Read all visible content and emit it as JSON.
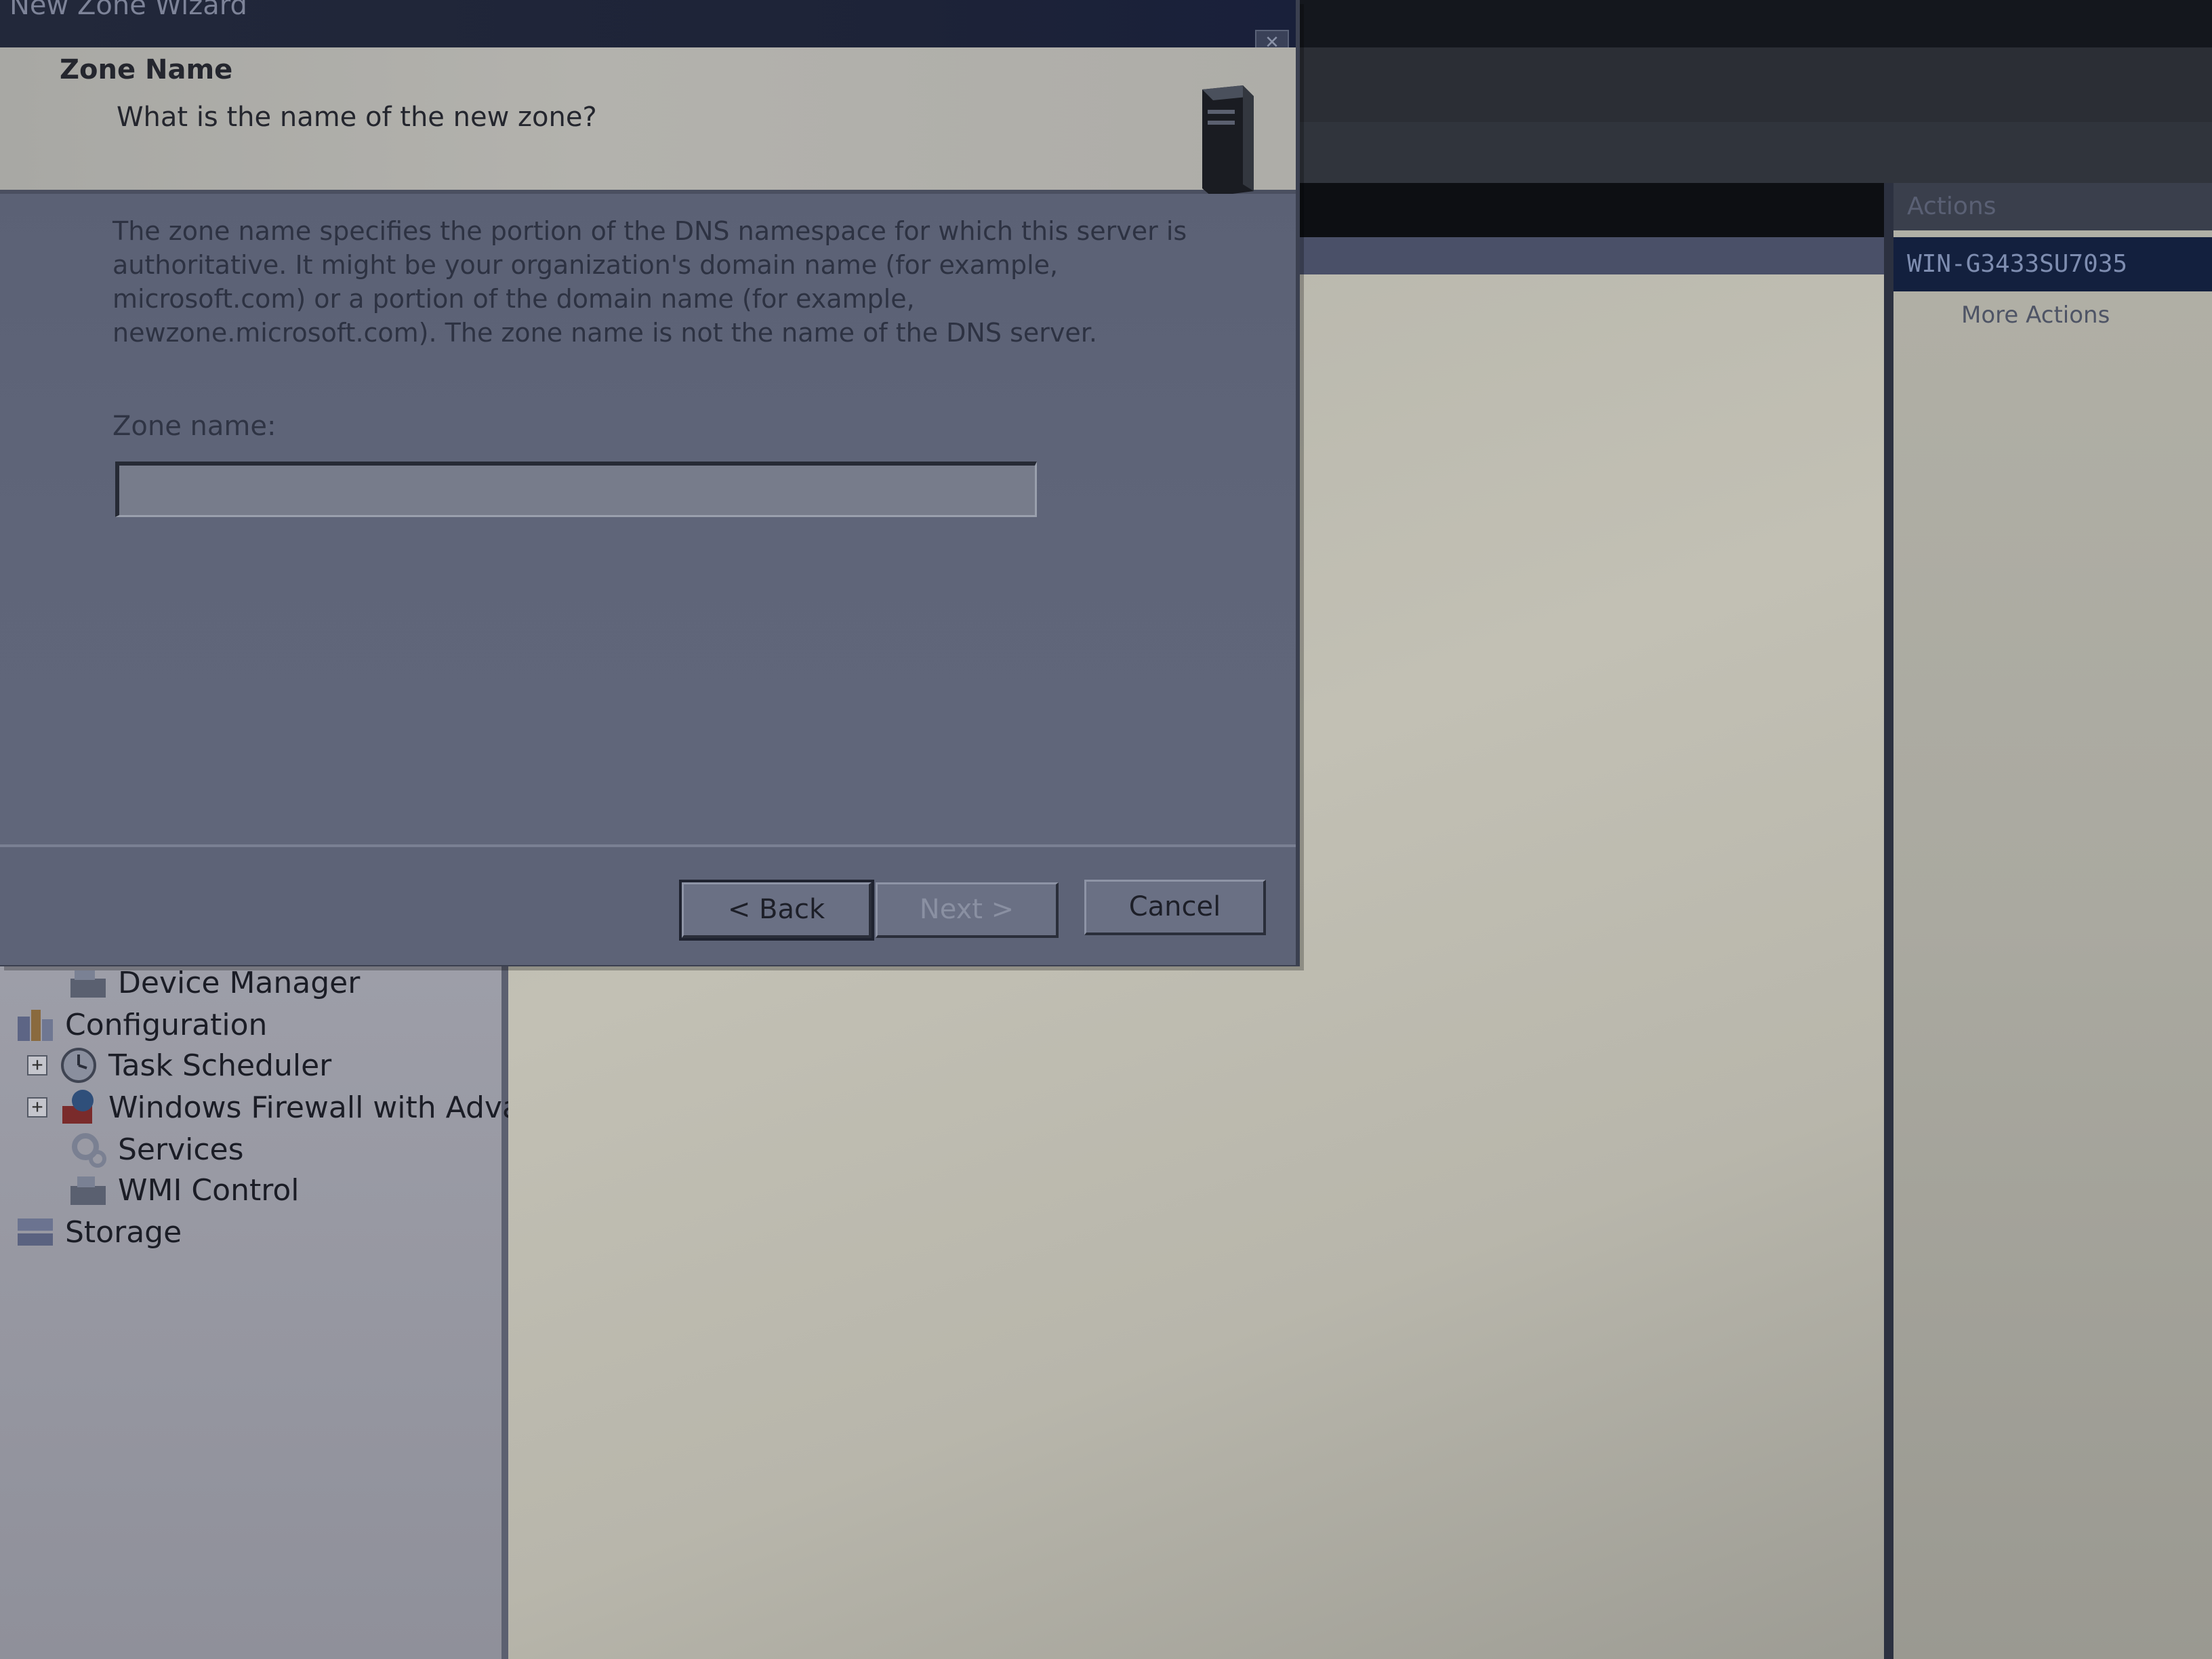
{
  "background_window": {
    "actions": {
      "header": "Actions",
      "server": "WIN-G3433SU7035",
      "more_actions": "More Actions"
    },
    "tree": {
      "items": [
        {
          "label": "Device Manager",
          "icon": "device-manager-icon",
          "expandable": false
        },
        {
          "label": "Configuration",
          "icon": "configuration-icon",
          "expandable": false
        },
        {
          "label": "Task Scheduler",
          "icon": "task-scheduler-icon",
          "expandable": true
        },
        {
          "label": "Windows Firewall with Adva",
          "icon": "firewall-icon",
          "expandable": true
        },
        {
          "label": "Services",
          "icon": "services-gear-icon",
          "expandable": false
        },
        {
          "label": "WMI Control",
          "icon": "wmi-control-icon",
          "expandable": false
        },
        {
          "label": "Storage",
          "icon": "storage-icon",
          "expandable": false
        }
      ]
    }
  },
  "wizard": {
    "title": "New Zone Wizard",
    "header_title": "Zone Name",
    "header_subtitle": "What is the name of the new zone?",
    "description": "The zone name specifies the portion of the DNS namespace for which this server is authoritative. It might be your organization's domain name (for example, microsoft.com) or a portion of the domain name (for example, newzone.microsoft.com). The zone name is not the name of the DNS server.",
    "zone_name_label": "Zone name:",
    "zone_name_value": "",
    "buttons": {
      "back": "< Back",
      "next": "Next >",
      "cancel": "Cancel"
    },
    "next_enabled": false
  }
}
